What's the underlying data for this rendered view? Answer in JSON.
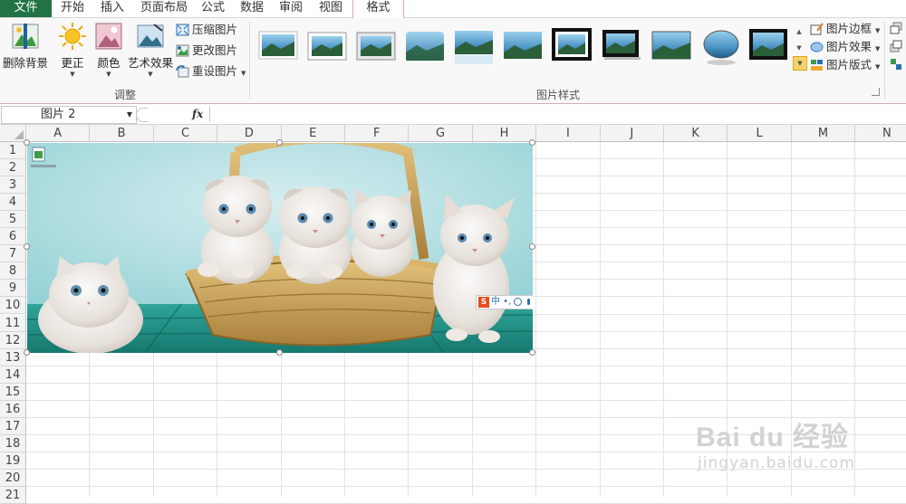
{
  "tabs": [
    {
      "label": "文件",
      "state": "file"
    },
    {
      "label": "开始"
    },
    {
      "label": "插入"
    },
    {
      "label": "页面布局"
    },
    {
      "label": "公式"
    },
    {
      "label": "数据"
    },
    {
      "label": "审阅"
    },
    {
      "label": "视图"
    },
    {
      "label": "格式",
      "state": "active"
    }
  ],
  "ribbon": {
    "adjust_group": {
      "label": "调整",
      "remove_bg": "删除背景",
      "corrections": "更正",
      "color": "颜色",
      "artistic": "艺术效果",
      "compress": "压缩图片",
      "change": "更改图片",
      "reset": "重设图片"
    },
    "styles_group": {
      "label": "图片样式",
      "border": "图片边框",
      "effects": "图片效果",
      "layout": "图片版式",
      "style_count": 11
    }
  },
  "formula_bar": {
    "name_box": "图片 2",
    "fx": "fx",
    "value": ""
  },
  "grid": {
    "columns": [
      "A",
      "B",
      "C",
      "D",
      "E",
      "F",
      "G",
      "H",
      "I",
      "J",
      "K",
      "L",
      "M",
      "N"
    ],
    "rows": [
      "1",
      "2",
      "3",
      "4",
      "5",
      "6",
      "7",
      "8",
      "9",
      "10",
      "11",
      "12",
      "13",
      "14",
      "15",
      "16",
      "17",
      "18",
      "19",
      "20",
      "21"
    ]
  },
  "picture": {
    "name": "图片 2",
    "subject": "five kittens in a wicker basket",
    "ime_toolbar": "S 中"
  },
  "watermark": {
    "brand": "Bai du 经验",
    "url": "jingyan.baidu.com"
  },
  "colors": {
    "file_tab": "#217346",
    "active_tab_border": "#e8a0c0",
    "ribbon_bg": "#f8f8f8"
  }
}
